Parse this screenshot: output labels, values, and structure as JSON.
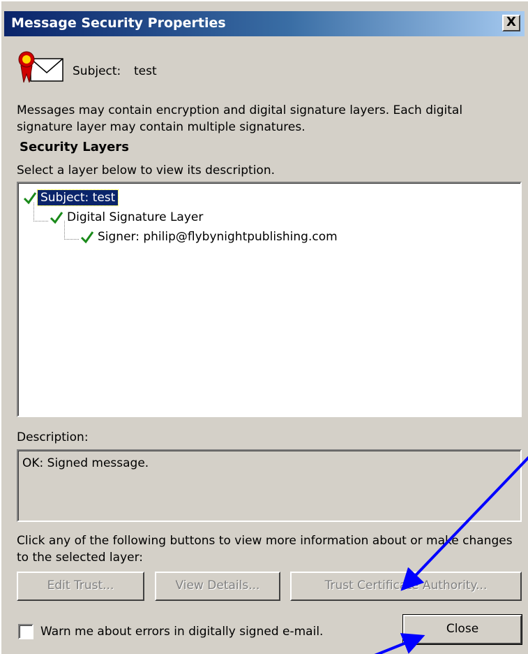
{
  "window": {
    "title": "Message Security Properties",
    "close_glyph": "X"
  },
  "header": {
    "icon": "certificate-envelope-icon",
    "subject_label": "Subject:",
    "subject_value": "test"
  },
  "intro_text": "Messages may contain encryption and digital signature layers. Each digital signature layer may contain multiple signatures.",
  "security_layers": {
    "heading": "Security Layers",
    "instruction": "Select a layer below to view its description.",
    "tree": [
      {
        "label": "Subject: test",
        "level": 0,
        "selected": true,
        "icon": "check-icon"
      },
      {
        "label": "Digital Signature Layer",
        "level": 1,
        "selected": false,
        "icon": "check-icon"
      },
      {
        "label": "Signer: philip@flybynightpublishing.com",
        "level": 2,
        "selected": false,
        "icon": "check-icon"
      }
    ]
  },
  "description": {
    "label": "Description:",
    "value": "OK: Signed message."
  },
  "buttons_instruction": "Click any of the following buttons to view more information about or make changes to the selected layer:",
  "buttons": {
    "edit_trust": "Edit Trust...",
    "view_details": "View Details...",
    "trust_ca": "Trust Certificate Authority...",
    "close": "Close"
  },
  "warn_checkbox": {
    "label": "Warn me about errors in digitally signed e-mail.",
    "checked": false
  },
  "colors": {
    "dialog_bg": "#d4d0c8",
    "titlebar_start": "#0a246a",
    "titlebar_end": "#a6caf0",
    "selection": "#0a246a",
    "check": "#1a8a1a",
    "annotation_arrow": "#0000ff"
  }
}
